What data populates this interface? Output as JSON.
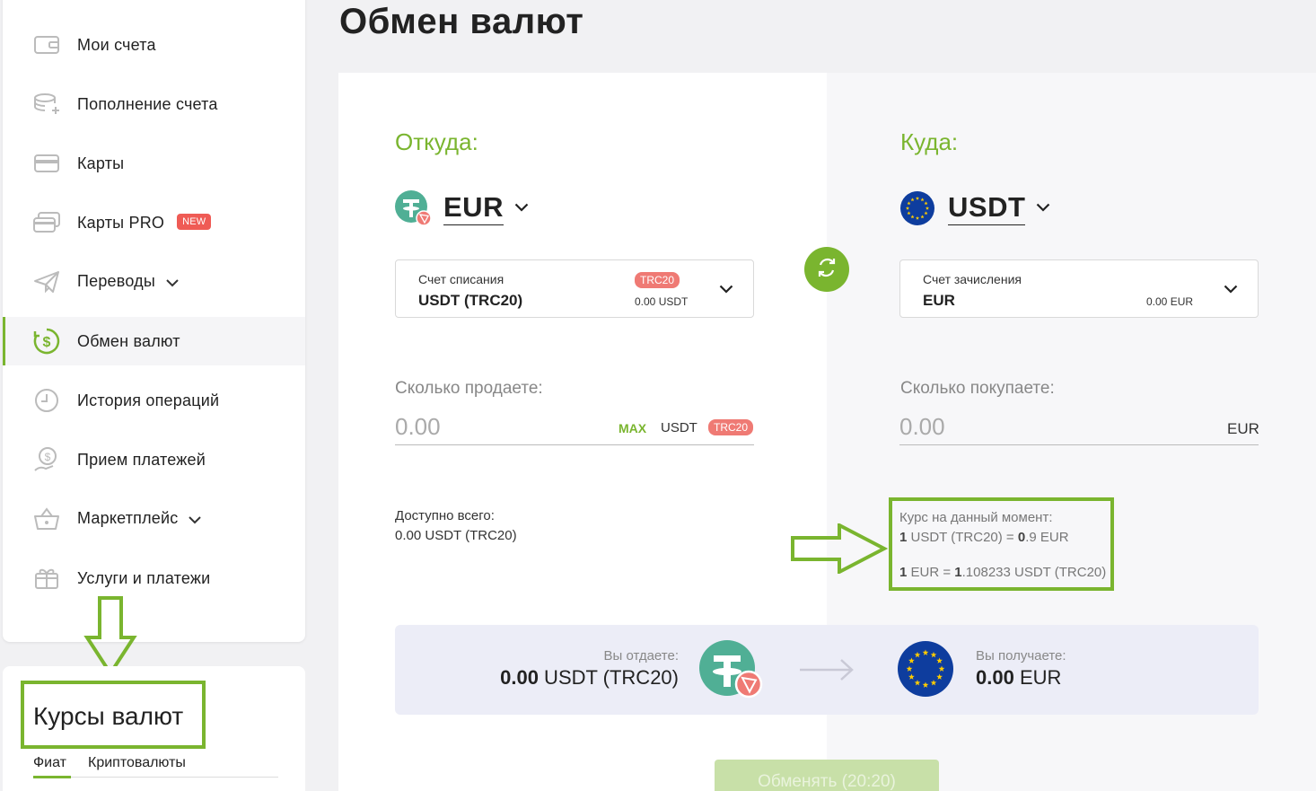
{
  "sidebar": {
    "items": [
      {
        "label": "Мои счета",
        "icon": "wallet-icon"
      },
      {
        "label": "Пополнение счета",
        "icon": "deposit-icon"
      },
      {
        "label": "Карты",
        "icon": "card-icon"
      },
      {
        "label": "Карты PRO",
        "icon": "card-pro-icon",
        "badge": "NEW"
      },
      {
        "label": "Переводы",
        "icon": "paper-plane-icon"
      },
      {
        "label": "Обмен валют",
        "icon": "dollar-exchange-icon"
      },
      {
        "label": "История операций",
        "icon": "clock-icon"
      },
      {
        "label": "Прием платежей",
        "icon": "payment-hand-icon"
      },
      {
        "label": "Маркетплейс",
        "icon": "basket-icon"
      },
      {
        "label": "Услуги и платежи",
        "icon": "gift-icon"
      }
    ]
  },
  "rates": {
    "title": "Курсы валют",
    "tabs": [
      "Фиат",
      "Криптовалюты"
    ]
  },
  "page": {
    "title": "Обмен валют"
  },
  "from": {
    "label": "Откуда:",
    "currency": "EUR",
    "account_caption": "Счет списания",
    "account_value": "USDT (TRC20)",
    "account_tag": "TRC20",
    "account_balance": "0.00 USDT",
    "amount_label": "Сколько продаете:",
    "amount_placeholder": "0.00",
    "max": "MAX",
    "amount_currency": "USDT",
    "amount_tag": "TRC20",
    "available_caption": "Доступно всего:",
    "available_value": "0.00 USDT (TRC20)"
  },
  "to": {
    "label": "Куда:",
    "currency": "USDT",
    "account_caption": "Счет зачисления",
    "account_value": "EUR",
    "account_balance": "0.00 EUR",
    "amount_label": "Сколько покупаете:",
    "amount_placeholder": "0.00",
    "amount_currency": "EUR"
  },
  "rate": {
    "caption": "Курс на данный момент:",
    "line1_a": "1",
    "line1_b": " USDT (TRC20) = ",
    "line1_c": "0",
    "line1_d": ".9 EUR",
    "line2_a": "1",
    "line2_b": " EUR = ",
    "line2_c": "1",
    "line2_d": ".108233 USDT (TRC20)"
  },
  "summary": {
    "give_caption": "Вы отдаете:",
    "give_amount": "0.00",
    "give_currency": " USDT (TRC20)",
    "get_caption": "Вы получаете:",
    "get_amount": "0.00",
    "get_currency": " EUR"
  },
  "submit": {
    "label": "Обменять (20:20)"
  },
  "colors": {
    "accent": "#7ab52f",
    "tag": "#ef7a74",
    "badge": "#ef5b55",
    "tether": "#50af95",
    "euro": "#0e3d9e"
  }
}
